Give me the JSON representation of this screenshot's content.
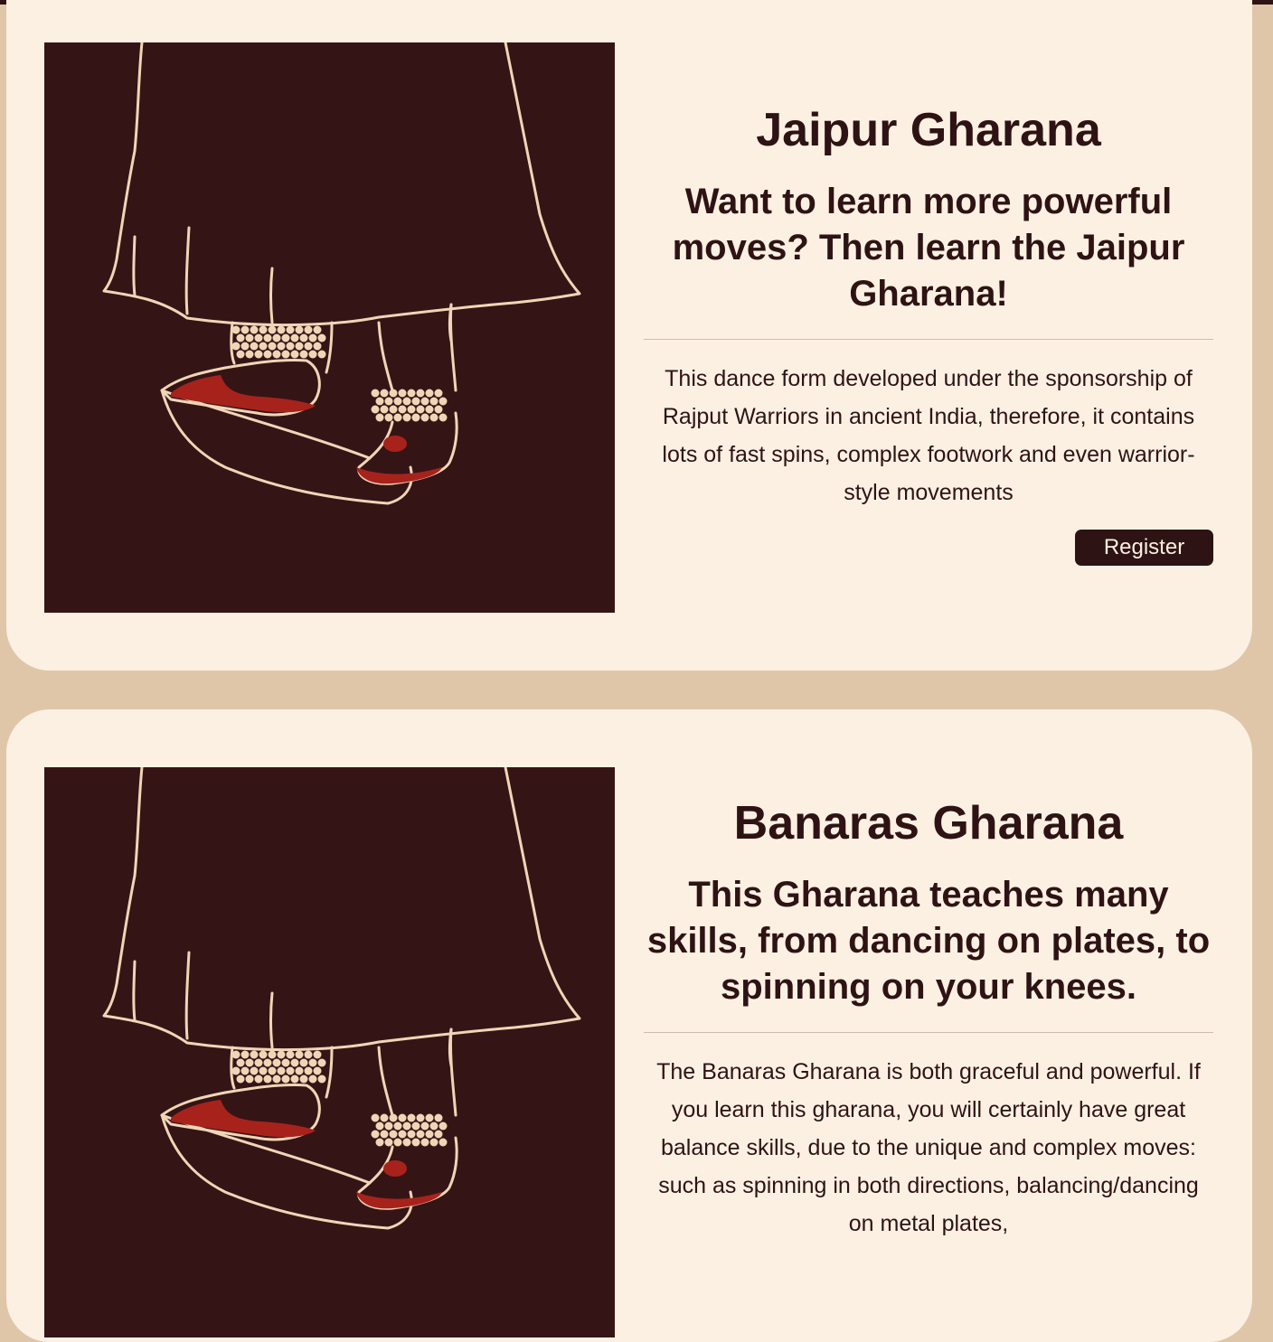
{
  "page": {
    "background_color": "#e0c6a8",
    "card_color": "#fcf0e3",
    "accent_dark": "#2e1314",
    "image_background": "#351416",
    "line_color": "#f0d6b6",
    "foot_red": "#a8221c"
  },
  "cards": [
    {
      "title": "Jaipur Gharana",
      "subtitle": "Want to learn more powerful moves? Then learn the Jaipur Gharana!",
      "description": "This dance form developed under the sponsorship of Rajput Warriors in ancient India, therefore, it contains lots of fast spins, complex footwork and even warrior-style movements",
      "button_label": "Register",
      "image_icon": "kathak-feet-illustration"
    },
    {
      "title": "Banaras Gharana",
      "subtitle": "This Gharana teaches many skills, from dancing on plates, to spinning on your knees.",
      "description": "The Banaras Gharana is both graceful and powerful. If you learn this gharana, you will certainly have great balance skills, due to the unique and complex moves: such as spinning in both directions, balancing/dancing on metal plates,",
      "image_icon": "kathak-feet-illustration"
    }
  ]
}
